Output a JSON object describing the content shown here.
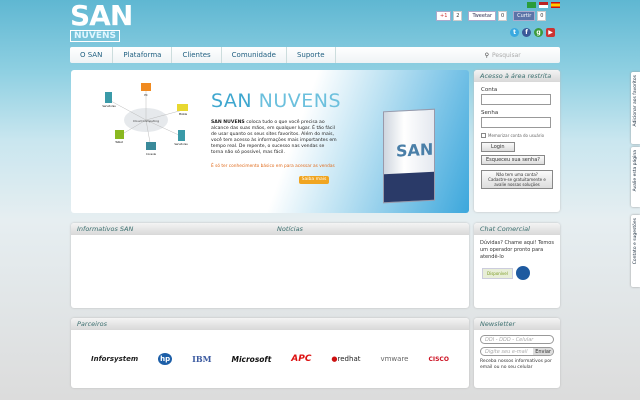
{
  "logo": {
    "line1": "SAN",
    "line2": "NUVENS"
  },
  "social": {
    "gplus_label": "+1",
    "gplus_count": "2",
    "tweet_label": "Tweetar",
    "tweet_count": "0",
    "like_label": "Curtir",
    "like_count": "0"
  },
  "nav": {
    "items": [
      "O SAN",
      "Plataforma",
      "Clientes",
      "Comunidade",
      "Suporte"
    ],
    "search_placeholder": "Pesquisar"
  },
  "banner": {
    "title_a": "SAN",
    "title_b": "NUVENS",
    "text_bold": "SAN NUVENS",
    "text": "coloca tudo o que você precisa ao alcance das suas mãos, em qualquer lugar. É tão fácil de usar quanto os seus sites favoritos. Além do mais, você tem acesso às informações mais importantes em tempo real. De repente, o sucesso nas vendas se torna não só possível, mas fácil.",
    "link": "É só ter conhecimento básico em para acessar as vendas",
    "button": "Saiba mais",
    "diagram": {
      "center": "Cloud Computing",
      "nodes": [
        "PC",
        "Mobile",
        "Servidores",
        "Console",
        "Tablet",
        "Servidores"
      ]
    },
    "box_label": "SAN"
  },
  "login": {
    "title": "Acesso à área restrita",
    "account_label": "Conta",
    "password_label": "Senha",
    "remember_label": "Memorizar conta do usuário",
    "login_button": "Login",
    "forgot_button": "Esqueceu sua senha?",
    "signup_button": "Não tem uma conta? Cadastre-se gratuitamente e avalie nossas soluções"
  },
  "info": {
    "tab1": "Informativos SAN",
    "tab2": "Notícias"
  },
  "chat": {
    "title": "Chat Comercial",
    "text": "Dúvidas? Chame aqui! Temos um operador pronto para atendê-lo",
    "status": "Disponível"
  },
  "partners": {
    "title": "Parceiros",
    "logos": [
      "Inforsystem",
      "hp",
      "IBM",
      "Microsoft",
      "APC",
      "redhat",
      "vmware",
      "CISCO"
    ]
  },
  "newsletter": {
    "title": "Newsletter",
    "phone_placeholder": "DDI - DDD - Celular",
    "email_placeholder": "Digite seu e-mail",
    "send": "Enviar",
    "text": "Receba nossos informativos por email ou no seu celular"
  },
  "side_tabs": [
    "Adicionar aos favoritos",
    "Avalie esta página",
    "Contato e sugestões"
  ]
}
